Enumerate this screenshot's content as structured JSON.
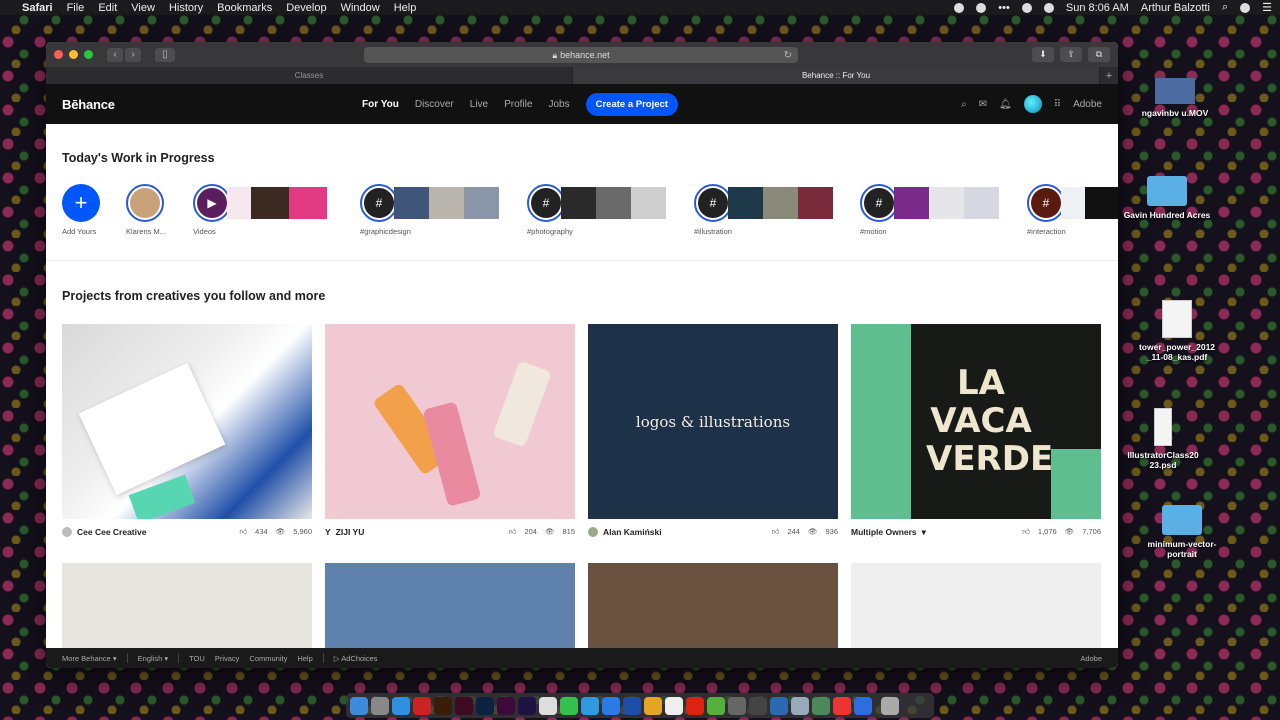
{
  "menubar": {
    "app": "Safari",
    "items": [
      "File",
      "Edit",
      "View",
      "History",
      "Bookmarks",
      "Develop",
      "Window",
      "Help"
    ],
    "clock": "Sun 8:06 AM",
    "user": "Arthur Balzotti"
  },
  "browser": {
    "url": "behance.net",
    "tabs": [
      {
        "label": "Classes"
      },
      {
        "label": "Behance :: For You"
      }
    ]
  },
  "nav": {
    "logo": "Bēhance",
    "links": [
      "For You",
      "Discover",
      "Live",
      "Profile",
      "Jobs"
    ],
    "cta": "Create a Project",
    "adobe": "Adobe"
  },
  "wip": {
    "title": "Today's Work in Progress",
    "items": [
      "Add Yours",
      "Klarens M...",
      "Videos",
      "#graphicdesign",
      "#photography",
      "#illustration",
      "#motion",
      "#interaction"
    ]
  },
  "projects": {
    "title": "Projects from creatives you follow and more",
    "cards": [
      {
        "owner": "Cee Cee Creative",
        "likes": "434",
        "views": "5,960"
      },
      {
        "owner": "ZIJI YU",
        "likes": "204",
        "views": "815"
      },
      {
        "owner": "Alan Kamiński",
        "likes": "244",
        "views": "936",
        "image_text": "logos & illustrations"
      },
      {
        "owner": "Multiple Owners",
        "likes": "1,076",
        "views": "7,706",
        "image_text": "LA VACA VERDE"
      }
    ]
  },
  "footer": {
    "items": [
      "More Behance",
      "English",
      "TOU",
      "Privacy",
      "Community",
      "Help",
      "AdChoices"
    ],
    "adobe": "Adobe"
  },
  "desktop": [
    {
      "label": "ngavinbv u.MOV"
    },
    {
      "label": "Gavin Hundred Acres"
    },
    {
      "label": "tower_power_2012 _11-08_kas.pdf"
    },
    {
      "label": "IllustratorClass20 23.psd"
    },
    {
      "label": "minimum-vector-portrait"
    }
  ],
  "colors": {
    "accent": "#0057ff",
    "nav_bg": "#111111"
  }
}
